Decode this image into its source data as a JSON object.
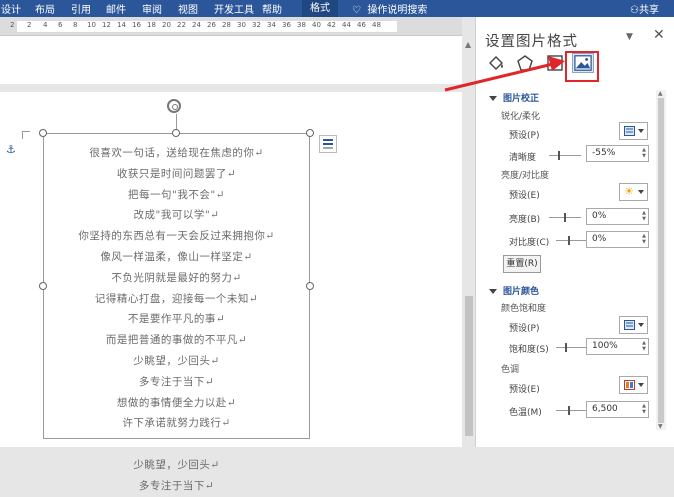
{
  "ribbon": {
    "tabs": [
      "设计",
      "布局",
      "引用",
      "邮件",
      "审阅",
      "视图",
      "开发工具",
      "帮助",
      "格式"
    ],
    "tell_me": "操作说明搜索",
    "share": "共享"
  },
  "ruler": {
    "numbers": [
      "2",
      "2",
      "4",
      "6",
      "8",
      "10",
      "12",
      "14",
      "16",
      "18",
      "20",
      "22",
      "24",
      "26",
      "28",
      "30",
      "32",
      "34",
      "36",
      "38",
      "40",
      "42",
      "44",
      "46",
      "48"
    ]
  },
  "poem": {
    "lines": [
      "很喜欢一句话，送给现在焦虑的你↵",
      "收获只是时间问题罢了↵",
      "把每一句\"我不会\"↵",
      "改成\"我可以学\"↵",
      "你坚持的东西总有一天会反过来拥抱你↵",
      "像风一样温柔，像山一样坚定↵",
      "不负光阴就是最好的努力↵",
      "记得精心打盘，迎接每一个未知↵",
      "不是要作平凡的事↵",
      "而是把普通的事做的不平凡↵",
      "少眺望，少回头↵",
      "多专注于当下↵",
      "想做的事情便全力以赴↵",
      "许下承诺就努力践行↵",
      "",
      "少眺望，少回头↵",
      "多专注于当下↵"
    ]
  },
  "pane": {
    "title": "设置图片格式",
    "dropdown": "▼",
    "close": "✕",
    "section_correction": "图片校正",
    "sharpen_soften": "锐化/柔化",
    "preset_label": "预设(P)",
    "sharpness_label": "清晰度",
    "sharpness_value": "-55%",
    "brightness_contrast": "亮度/对比度",
    "preset_label2": "预设(E)",
    "brightness_label": "亮度(B)",
    "brightness_value": "0%",
    "contrast_label": "对比度(C)",
    "contrast_value": "0%",
    "reset_label": "重置(R)",
    "section_color": "图片颜色",
    "saturation_heading": "颜色饱和度",
    "preset_label3": "预设(P)",
    "saturation_label": "饱和度(S)",
    "saturation_value": "100%",
    "tone_heading": "色调",
    "preset_label4": "预设(E)",
    "temperature_label": "色温(M)",
    "temperature_value": "6,500"
  },
  "colors": {
    "ribbon": "#2b579a",
    "highlight": "#e0262a",
    "arrow": "#e0262a"
  }
}
